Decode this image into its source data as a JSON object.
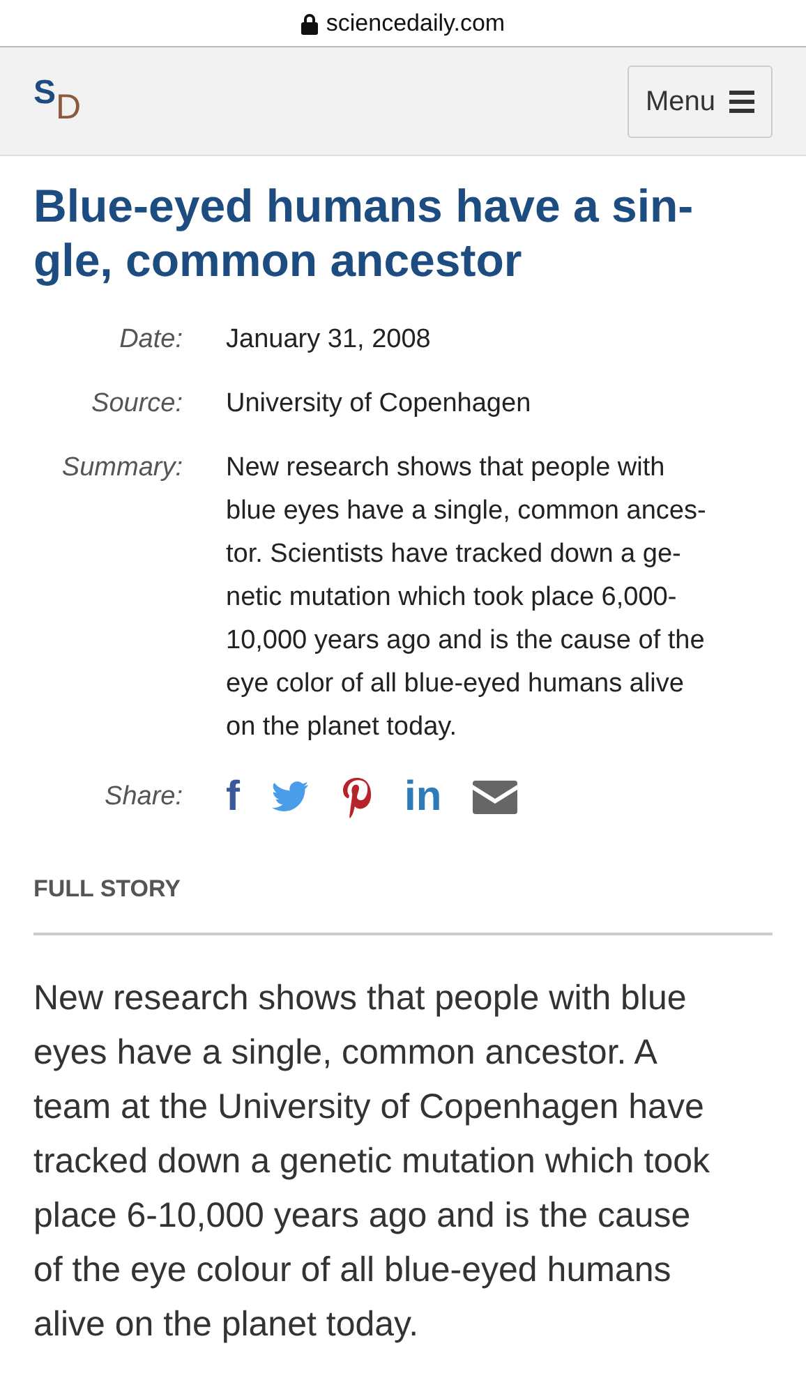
{
  "address_bar": {
    "url": "sciencedaily.com"
  },
  "header": {
    "logo": {
      "first": "S",
      "second": "D"
    },
    "menu_button": {
      "label": "Menu"
    }
  },
  "headline": {
    "lines": [
      "Blue-eyed humans have a sin-",
      "gle, common ancestor"
    ]
  },
  "meta": [
    {
      "label": "Date:",
      "lines": [
        "January 31, 2008"
      ]
    },
    {
      "label": "Source:",
      "lines": [
        "University of Copenhagen"
      ]
    },
    {
      "label": "Summary:",
      "lines": [
        "New research shows that people with",
        "blue eyes have a single, common ances-",
        "tor. Scientists have tracked down a ge-",
        "netic mutation which took place 6,000-",
        "10,000 years ago and is the cause of the",
        "eye color of all blue-eyed humans alive",
        "on the planet today."
      ]
    }
  ],
  "share": {
    "label": "Share:",
    "items": [
      {
        "kind": "text",
        "text": "f",
        "color": "#3b5998"
      },
      {
        "kind": "bird",
        "color": "#4a9de8"
      },
      {
        "kind": "pin",
        "color": "#b7232a"
      },
      {
        "kind": "text",
        "text": "in",
        "color": "#2f7bb8"
      },
      {
        "kind": "envelope",
        "color": "#666666"
      }
    ]
  },
  "full_story": {
    "heading": "FULL STORY",
    "lines": [
      "New research shows that people with blue",
      "eyes have a single, common ancestor. A",
      "team at the University of Copenhagen have",
      "tracked down a genetic mutation which took",
      "place 6-10,000 years ago and is the cause",
      "of the eye colour of all blue-eyed humans",
      "alive on the planet today."
    ]
  }
}
